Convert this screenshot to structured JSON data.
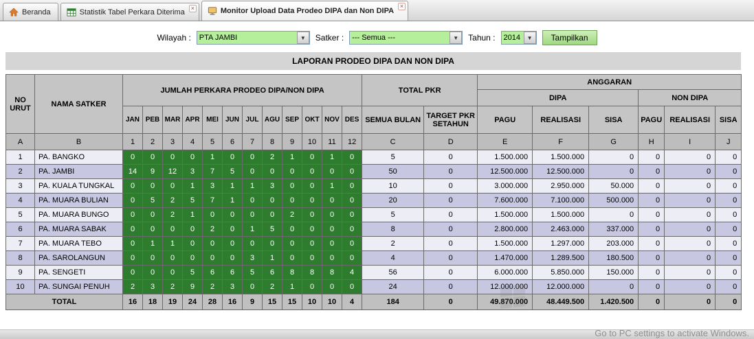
{
  "tabs": [
    {
      "label": "Beranda",
      "icon": "home-icon",
      "closable": false,
      "active": false
    },
    {
      "label": "Statistik Tabel Perkara Diterima",
      "icon": "table-icon",
      "closable": true,
      "active": false
    },
    {
      "label": "Monitor Upload Data Prodeo DIPA dan Non DIPA",
      "icon": "monitor-icon",
      "closable": true,
      "active": true
    }
  ],
  "icons": {
    "close": "×",
    "dropdown_arrow": "▼"
  },
  "filters": {
    "wilayah_label": "Wilayah :",
    "wilayah_value": "PTA JAMBI",
    "satker_label": "Satker :",
    "satker_value": "--- Semua ---",
    "tahun_label": "Tahun :",
    "tahun_value": "2014",
    "submit_label": "Tampilkan"
  },
  "report": {
    "title": "LAPORAN PRODEO DIPA DAN NON DIPA",
    "headers": {
      "no_urut": "NO URUT",
      "nama_satker": "NAMA SATKER",
      "jumlah_perkara": "JUMLAH PERKARA PRODEO DIPA/NON DIPA",
      "total_pkr": "TOTAL PKR",
      "anggaran": "ANGGARAN",
      "dipa": "DIPA",
      "non_dipa": "NON DIPA",
      "months": [
        "JAN",
        "PEB",
        "MAR",
        "APR",
        "MEI",
        "JUN",
        "JUL",
        "AGU",
        "SEP",
        "OKT",
        "NOV",
        "DES"
      ],
      "semua_bulan": "SEMUA BULAN",
      "target_pkr": "TARGET PKR SETAHUN",
      "pagu": "PAGU",
      "realisasi": "REALISASI",
      "sisa": "SISA",
      "letters": [
        "A",
        "B",
        "1",
        "2",
        "3",
        "4",
        "5",
        "6",
        "7",
        "8",
        "9",
        "10",
        "11",
        "12",
        "C",
        "D",
        "E",
        "F",
        "G",
        "H",
        "I",
        "J"
      ]
    },
    "rows": [
      {
        "no": "1",
        "satker": "PA. BANGKO",
        "months": [
          0,
          0,
          0,
          0,
          1,
          0,
          0,
          2,
          1,
          0,
          1,
          0
        ],
        "semua_bulan": "5",
        "target": "0",
        "dipa_pagu": "1.500.000",
        "dipa_realisasi": "1.500.000",
        "dipa_sisa": "0",
        "nd_pagu": "0",
        "nd_realisasi": "0",
        "nd_sisa": "0"
      },
      {
        "no": "2",
        "satker": "PA. JAMBI",
        "months": [
          14,
          9,
          12,
          3,
          7,
          5,
          0,
          0,
          0,
          0,
          0,
          0
        ],
        "semua_bulan": "50",
        "target": "0",
        "dipa_pagu": "12.500.000",
        "dipa_realisasi": "12.500.000",
        "dipa_sisa": "0",
        "nd_pagu": "0",
        "nd_realisasi": "0",
        "nd_sisa": "0"
      },
      {
        "no": "3",
        "satker": "PA. KUALA TUNGKAL",
        "months": [
          0,
          0,
          0,
          1,
          3,
          1,
          1,
          3,
          0,
          0,
          1,
          0
        ],
        "semua_bulan": "10",
        "target": "0",
        "dipa_pagu": "3.000.000",
        "dipa_realisasi": "2.950.000",
        "dipa_sisa": "50.000",
        "nd_pagu": "0",
        "nd_realisasi": "0",
        "nd_sisa": "0"
      },
      {
        "no": "4",
        "satker": "PA. MUARA BULIAN",
        "months": [
          0,
          5,
          2,
          5,
          7,
          1,
          0,
          0,
          0,
          0,
          0,
          0
        ],
        "semua_bulan": "20",
        "target": "0",
        "dipa_pagu": "7.600.000",
        "dipa_realisasi": "7.100.000",
        "dipa_sisa": "500.000",
        "nd_pagu": "0",
        "nd_realisasi": "0",
        "nd_sisa": "0"
      },
      {
        "no": "5",
        "satker": "PA. MUARA BUNGO",
        "months": [
          0,
          0,
          2,
          1,
          0,
          0,
          0,
          0,
          2,
          0,
          0,
          0
        ],
        "semua_bulan": "5",
        "target": "0",
        "dipa_pagu": "1.500.000",
        "dipa_realisasi": "1.500.000",
        "dipa_sisa": "0",
        "nd_pagu": "0",
        "nd_realisasi": "0",
        "nd_sisa": "0"
      },
      {
        "no": "6",
        "satker": "PA. MUARA SABAK",
        "months": [
          0,
          0,
          0,
          0,
          2,
          0,
          1,
          5,
          0,
          0,
          0,
          0
        ],
        "semua_bulan": "8",
        "target": "0",
        "dipa_pagu": "2.800.000",
        "dipa_realisasi": "2.463.000",
        "dipa_sisa": "337.000",
        "nd_pagu": "0",
        "nd_realisasi": "0",
        "nd_sisa": "0"
      },
      {
        "no": "7",
        "satker": "PA. MUARA TEBO",
        "months": [
          0,
          1,
          1,
          0,
          0,
          0,
          0,
          0,
          0,
          0,
          0,
          0
        ],
        "semua_bulan": "2",
        "target": "0",
        "dipa_pagu": "1.500.000",
        "dipa_realisasi": "1.297.000",
        "dipa_sisa": "203.000",
        "nd_pagu": "0",
        "nd_realisasi": "0",
        "nd_sisa": "0"
      },
      {
        "no": "8",
        "satker": "PA. SAROLANGUN",
        "months": [
          0,
          0,
          0,
          0,
          0,
          0,
          3,
          1,
          0,
          0,
          0,
          0
        ],
        "semua_bulan": "4",
        "target": "0",
        "dipa_pagu": "1.470.000",
        "dipa_realisasi": "1.289.500",
        "dipa_sisa": "180.500",
        "nd_pagu": "0",
        "nd_realisasi": "0",
        "nd_sisa": "0"
      },
      {
        "no": "9",
        "satker": "PA. SENGETI",
        "months": [
          0,
          0,
          0,
          5,
          6,
          6,
          5,
          6,
          8,
          8,
          8,
          4
        ],
        "semua_bulan": "56",
        "target": "0",
        "dipa_pagu": "6.000.000",
        "dipa_realisasi": "5.850.000",
        "dipa_sisa": "150.000",
        "nd_pagu": "0",
        "nd_realisasi": "0",
        "nd_sisa": "0"
      },
      {
        "no": "10",
        "satker": "PA. SUNGAI PENUH",
        "months": [
          2,
          3,
          2,
          9,
          2,
          3,
          0,
          2,
          1,
          0,
          0,
          0
        ],
        "semua_bulan": "24",
        "target": "0",
        "dipa_pagu": "12.000.000",
        "dipa_realisasi": "12.000.000",
        "dipa_sisa": "0",
        "nd_pagu": "0",
        "nd_realisasi": "0",
        "nd_sisa": "0"
      }
    ],
    "total_row": {
      "label": "TOTAL",
      "months": [
        "16",
        "18",
        "19",
        "24",
        "28",
        "16",
        "9",
        "15",
        "15",
        "10",
        "10",
        "4"
      ],
      "semua_bulan": "184",
      "target": "0",
      "dipa_pagu": "49.870.000",
      "dipa_realisasi": "48.449.500",
      "dipa_sisa": "1.420.500",
      "nd_pagu": "0",
      "nd_realisasi": "0",
      "nd_sisa": "0"
    }
  },
  "watermark": {
    "text": "Go to PC settings to activate Windows."
  },
  "colors": {
    "green_cell": "#2e7d2e",
    "select_bg": "#b5ef9b",
    "header_bg": "#c5c5c5",
    "row_bg": "#ededf5",
    "row_alt_bg": "#c7c7e1",
    "total_bg": "#c0c0c0",
    "title_bg": "#d5d5d5"
  }
}
